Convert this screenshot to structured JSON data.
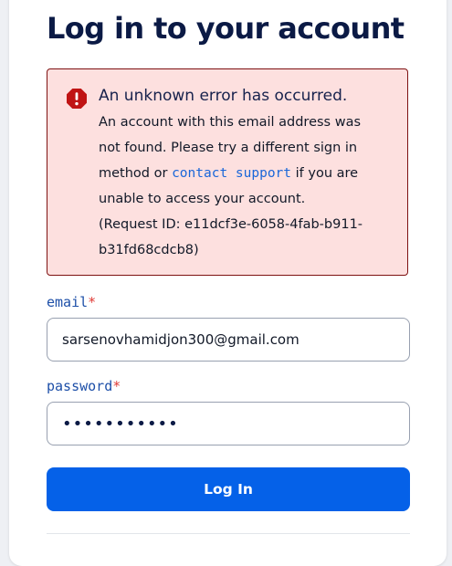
{
  "page": {
    "title": "Log in to your account"
  },
  "alert": {
    "heading": "An unknown error has occurred.",
    "line1": "An account with this email address was",
    "line2": "not found. Please try a different sign in",
    "line3_before": "method or ",
    "link_text": "contact support",
    "line3_after": " if you are",
    "line4": "unable to access your account.",
    "line5": "(Request ID: e11dcf3e-6058-4fab-b911-",
    "line6": "b31fd68cdcb8)",
    "icon": "error-octagon-icon"
  },
  "email": {
    "label": "email",
    "required_marker": "*",
    "value": "sarsenovhamidjon300@gmail.com"
  },
  "password": {
    "label": "password",
    "required_marker": "*",
    "value": "•••••••••••"
  },
  "submit": {
    "label": "Log In"
  },
  "colors": {
    "primary": "#0561e8",
    "title": "#0b1a45",
    "error_bg": "#fde0df",
    "error_border": "#7e1212",
    "error_icon": "#c01414",
    "label": "#1d4fa8",
    "link": "#1a66d9",
    "required": "#e03a35"
  }
}
